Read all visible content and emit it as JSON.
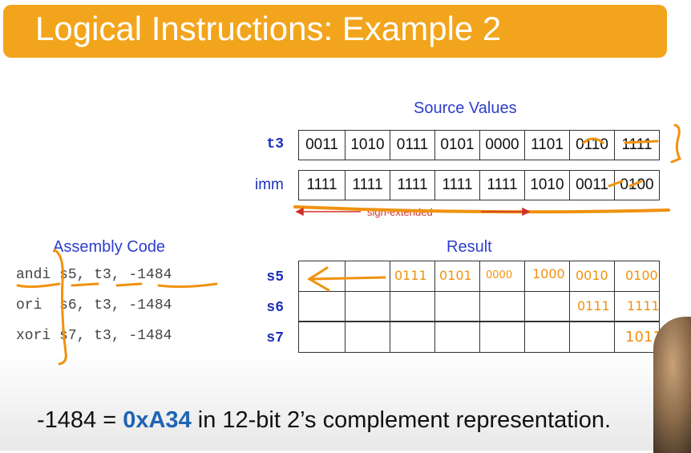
{
  "title": "Logical Instructions: Example 2",
  "source_values_label": "Source Values",
  "t3": {
    "label": "t3",
    "bits": [
      "0011",
      "1010",
      "0111",
      "0101",
      "0000",
      "1101",
      "0110",
      "1111"
    ]
  },
  "imm": {
    "label": "imm",
    "bits": [
      "1111",
      "1111",
      "1111",
      "1111",
      "1111",
      "1010",
      "0011",
      "0100"
    ]
  },
  "sign_extended_label": "sign-extended",
  "assembly_code_label": "Assembly Code",
  "result_label": "Result",
  "code": [
    {
      "op": "andi",
      "args": " s5, t3, -1484"
    },
    {
      "op": "ori ",
      "args": " s6, t3, -1484"
    },
    {
      "op": "xori",
      "args": " s7, t3, -1484"
    }
  ],
  "results": [
    {
      "label": "s5",
      "bits": [
        "",
        "",
        "",
        "",
        "",
        "",
        "",
        ""
      ]
    },
    {
      "label": "s6",
      "bits": [
        "",
        "",
        "",
        "",
        "",
        "",
        "",
        ""
      ]
    },
    {
      "label": "s7",
      "bits": [
        "",
        "",
        "",
        "",
        "",
        "",
        "",
        ""
      ]
    }
  ],
  "handwriting": {
    "s5": [
      "0111",
      "0101",
      "0000",
      "1000",
      "0010",
      "0100"
    ],
    "s6": [
      "0111",
      "1111"
    ],
    "s7": [
      "1011"
    ]
  },
  "bottom_note": {
    "prefix": "-1484 = ",
    "hex": "0xA34",
    "suffix": " in 12-bit 2’s complement representation."
  },
  "colors": {
    "title_bar": "#f2a51c",
    "heading_blue": "#2e3ec9",
    "annotation_orange": "#f0920f",
    "sign_extend_red": "#d0302a",
    "hex_blue": "#1e64b4"
  }
}
